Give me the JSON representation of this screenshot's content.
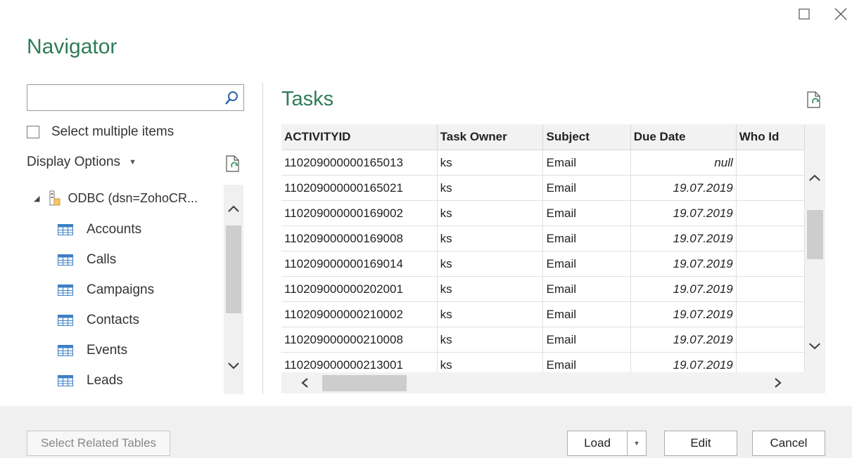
{
  "window": {
    "title": "Navigator",
    "maximize_icon": "maximize-icon",
    "close_icon": "close-icon"
  },
  "search": {
    "value": "",
    "placeholder": ""
  },
  "select_multiple_label": "Select multiple items",
  "display_options_label": "Display Options",
  "tree": {
    "root_label": "ODBC (dsn=ZohoCR...",
    "items": [
      {
        "label": "Accounts"
      },
      {
        "label": "Calls"
      },
      {
        "label": "Campaigns"
      },
      {
        "label": "Contacts"
      },
      {
        "label": "Events"
      },
      {
        "label": "Leads"
      }
    ]
  },
  "preview": {
    "title": "Tasks",
    "columns": [
      "ACTIVITYID",
      "Task Owner",
      "Subject",
      "Due Date",
      "Who Id"
    ],
    "rows": [
      [
        "110209000000165013",
        "ks",
        "Email",
        "null",
        ""
      ],
      [
        "110209000000165021",
        "ks",
        "Email",
        "19.07.2019",
        ""
      ],
      [
        "110209000000169002",
        "ks",
        "Email",
        "19.07.2019",
        ""
      ],
      [
        "110209000000169008",
        "ks",
        "Email",
        "19.07.2019",
        ""
      ],
      [
        "110209000000169014",
        "ks",
        "Email",
        "19.07.2019",
        ""
      ],
      [
        "110209000000202001",
        "ks",
        "Email",
        "19.07.2019",
        ""
      ],
      [
        "110209000000210002",
        "ks",
        "Email",
        "19.07.2019",
        ""
      ],
      [
        "110209000000210008",
        "ks",
        "Email",
        "19.07.2019",
        ""
      ],
      [
        "110209000000213001",
        "ks",
        "Email",
        "19.07.2019",
        ""
      ]
    ]
  },
  "footer": {
    "select_related_label": "Select Related Tables",
    "load_label": "Load",
    "edit_label": "Edit",
    "cancel_label": "Cancel"
  },
  "colors": {
    "accent": "#2f7b5a",
    "table_icon": "#3d7fc4"
  }
}
